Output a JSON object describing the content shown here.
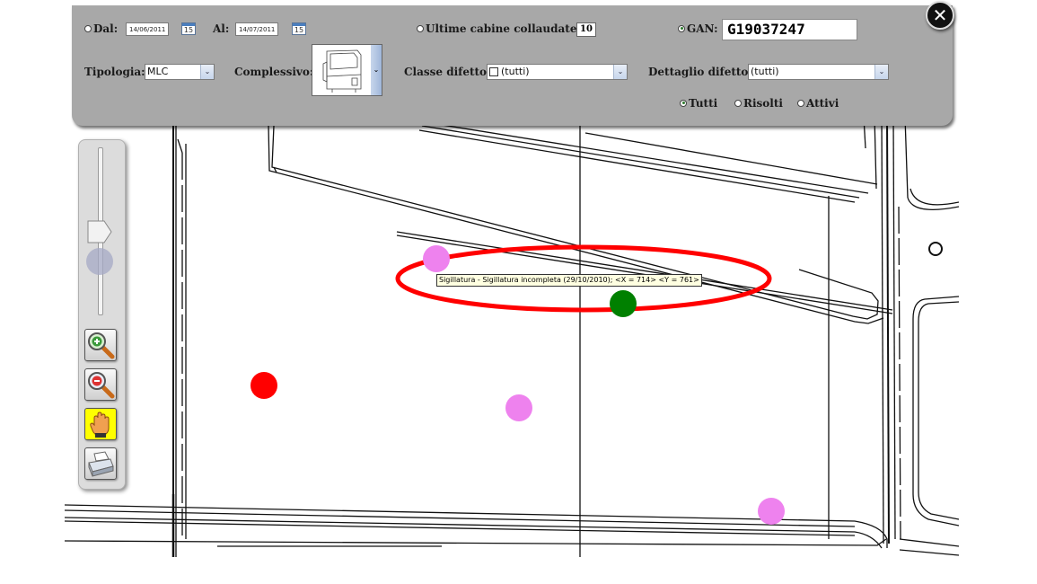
{
  "filters": {
    "from": {
      "label": "Dal:",
      "value": "14/06/2011"
    },
    "to": {
      "label": "Al:",
      "value": "14/07/2011"
    },
    "calendar_day": "15",
    "last_cabins": {
      "label": "Ultime cabine collaudate:",
      "value": "10"
    },
    "gan": {
      "label": "GAN:",
      "value": "G19037247"
    },
    "tipologia": {
      "label": "Tipologia:",
      "value": "MLC"
    },
    "complessivo": {
      "label": "Complessivo:"
    },
    "classe_difetto": {
      "label": "Classe difetto:",
      "value": "(tutti)"
    },
    "dettaglio_difetto": {
      "label": "Dettaglio difetto:",
      "value": "(tutti)"
    },
    "status_options": [
      "Tutti",
      "Risolti",
      "Attivi"
    ],
    "selected_status": "Tutti"
  },
  "tooltip": "Sigillatura - Sigillatura incompleta (29/10/2010); <X = 714> <Y = 761>",
  "toolbar": {
    "icons": [
      "zoom-in-icon",
      "zoom-out-icon",
      "pan-hand-icon",
      "printer-icon"
    ],
    "zoom_level": 0.53
  },
  "defects": [
    {
      "color": "#ee82ee",
      "status": "attivo"
    },
    {
      "color": "#008000",
      "status": "risolto"
    },
    {
      "color": "#ff0000",
      "status": "attivo"
    },
    {
      "color": "#ee82ee",
      "status": "attivo"
    },
    {
      "color": "#ee82ee",
      "status": "attivo"
    }
  ],
  "colors": {
    "panel": "#a8a8a8",
    "highlight_ellipse": "#ff0000",
    "hand_button": "#ffff00"
  }
}
